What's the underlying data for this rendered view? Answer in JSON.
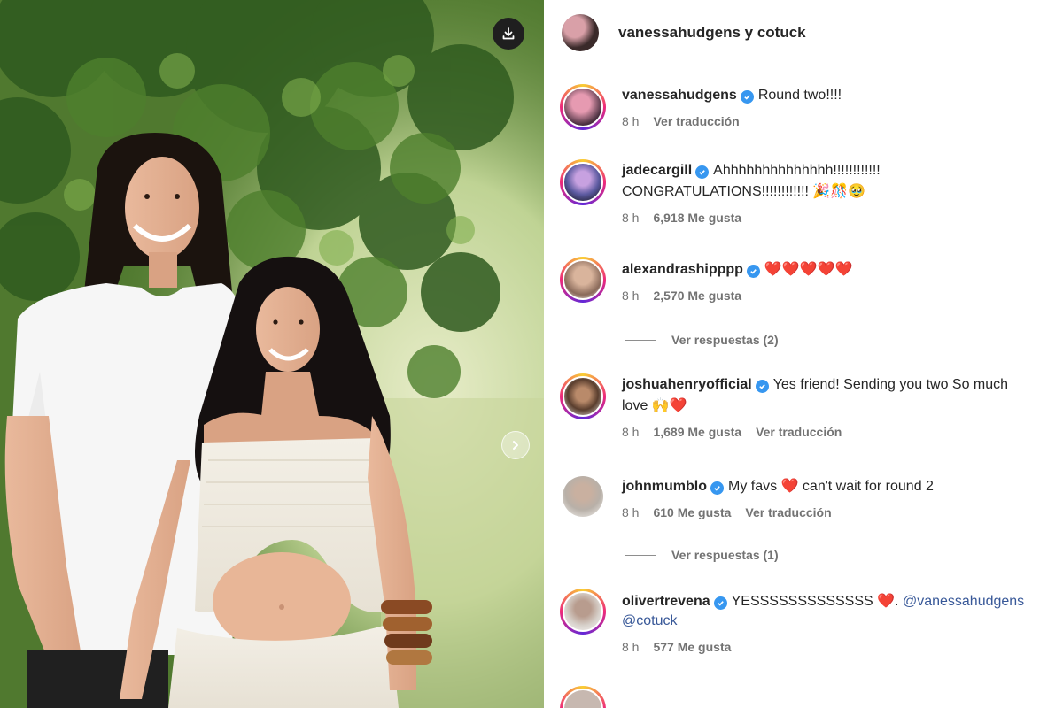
{
  "header": {
    "title": "vanessahudgens y cotuck"
  },
  "comments": [
    {
      "user": "vanessahudgens",
      "text": "Round two!!!!",
      "time": "8 h",
      "likes": "",
      "translate": "Ver traducción"
    },
    {
      "user": "jadecargill",
      "text": "Ahhhhhhhhhhhhhh!!!!!!!!!!!!",
      "text2": "CONGRATULATIONS!!!!!!!!!!!! 🎉🎊🥹",
      "time": "8 h",
      "likes": "6,918 Me gusta",
      "translate": ""
    },
    {
      "user": "alexandrashipppp",
      "text": "❤️❤️❤️❤️❤️",
      "time": "8 h",
      "likes": "2,570 Me gusta",
      "translate": ""
    },
    {
      "user": "joshuahenryofficial",
      "text": "Yes friend! Sending you two So much",
      "text2": "love 🙌❤️",
      "time": "8 h",
      "likes": "1,689 Me gusta",
      "translate": "Ver traducción"
    },
    {
      "user": "johnmumblo",
      "text": "My favs ❤️ can't wait for round 2",
      "time": "8 h",
      "likes": "610 Me gusta",
      "translate": "Ver traducción"
    },
    {
      "user": "olivertrevena",
      "text": "YESSSSSSSSSSSSS ❤️.",
      "mention": "@vanessahudgens",
      "mention2": "@cotuck",
      "time": "8 h",
      "likes": "577 Me gusta",
      "translate": ""
    }
  ],
  "replies": [
    {
      "label": "Ver respuestas (2)"
    },
    {
      "label": "Ver respuestas (1)"
    }
  ],
  "icons": {
    "download": "download-icon",
    "next": "chevron-right-icon",
    "verified": "verified-badge-icon"
  },
  "colors": {
    "verified": "#3797f0",
    "meta": "#737373",
    "mention": "#385898"
  }
}
